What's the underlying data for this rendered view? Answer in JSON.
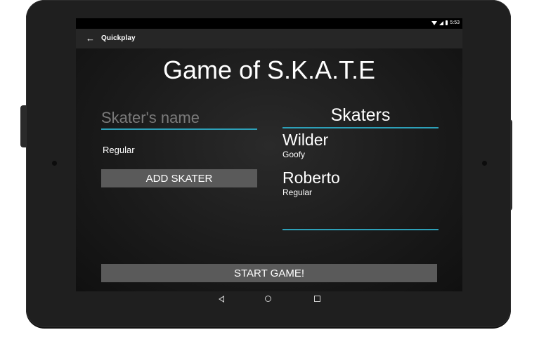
{
  "status_bar": {
    "time": "5:53"
  },
  "action_bar": {
    "title": "Quickplay"
  },
  "main": {
    "title": "Game of S.K.A.T.E",
    "name_placeholder": "Skater's name",
    "stance": "Regular",
    "add_button": "ADD SKATER",
    "start_button": "START GAME!"
  },
  "skaters": {
    "header": "Skaters",
    "items": [
      {
        "name": "Wilder",
        "stance": "Goofy"
      },
      {
        "name": "Roberto",
        "stance": "Regular"
      }
    ]
  },
  "icons": {
    "back": "arrow-left-icon",
    "nav_back": "triangle-back-icon",
    "nav_home": "circle-home-icon",
    "nav_recent": "square-recent-icon"
  },
  "colors": {
    "accent": "#2da0b8",
    "button": "#5a5a5a",
    "action_bar": "#262626"
  }
}
